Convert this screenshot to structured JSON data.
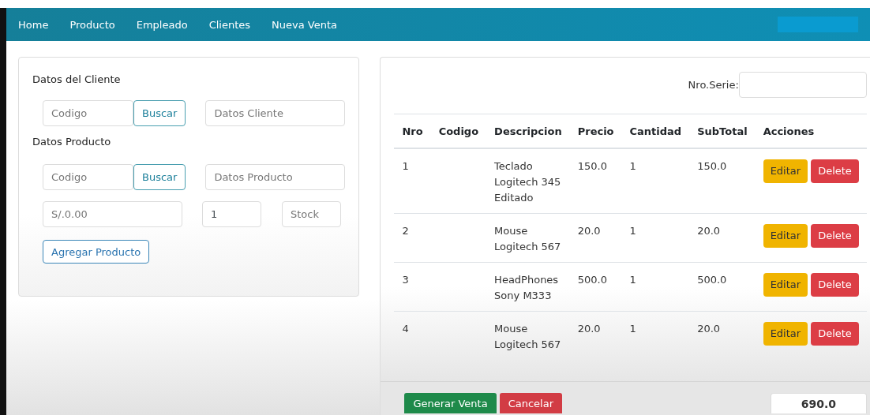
{
  "nav": {
    "links": [
      {
        "label": "Home"
      },
      {
        "label": "Producto"
      },
      {
        "label": "Empleado"
      },
      {
        "label": "Clientes"
      },
      {
        "label": "Nueva Venta"
      }
    ]
  },
  "client_form": {
    "client_title": "Datos del Cliente",
    "client_code": {
      "placeholder": "Codigo"
    },
    "client_search": "Buscar",
    "client_data": {
      "placeholder": "Datos Cliente"
    },
    "product_title": "Datos Producto",
    "product_code": {
      "placeholder": "Codigo"
    },
    "product_search": "Buscar",
    "product_data": {
      "placeholder": "Datos Producto"
    },
    "price": {
      "placeholder": "S/.0.00"
    },
    "quantity": {
      "value": "1"
    },
    "stock": {
      "placeholder": "Stock"
    },
    "add_button": "Agregar Producto"
  },
  "sale": {
    "serial_label": "Nro.Serie:",
    "table": {
      "columns": [
        "Nro",
        "Codigo",
        "Descripcion",
        "Precio",
        "Cantidad",
        "SubTotal",
        "Acciones"
      ],
      "rows": [
        {
          "nro": "1",
          "descripcion": "Teclado Logitech 345 Editado",
          "precio": "150.0",
          "cantidad": "1",
          "subtotal": "150.0",
          "actions": [
            "Editar",
            "Delete"
          ]
        },
        {
          "nro": "2",
          "descripcion": "Mouse Logitech 567",
          "precio": "20.0",
          "cantidad": "1",
          "subtotal": "20.0",
          "actions": [
            "Editar",
            "Delete"
          ]
        },
        {
          "nro": "3",
          "descripcion": "HeadPhones Sony M333",
          "precio": "500.0",
          "cantidad": "1",
          "subtotal": "500.0",
          "actions": [
            "Editar",
            "Delete"
          ]
        },
        {
          "nro": "4",
          "descripcion": "Mouse Logitech 567",
          "precio": "20.0",
          "cantidad": "1",
          "subtotal": "20.0",
          "actions": [
            "Editar",
            "Delete"
          ]
        }
      ]
    },
    "generate_button": "Generar Venta",
    "cancel_button": "Cancelar",
    "total": {
      "value": "690.0"
    }
  }
}
